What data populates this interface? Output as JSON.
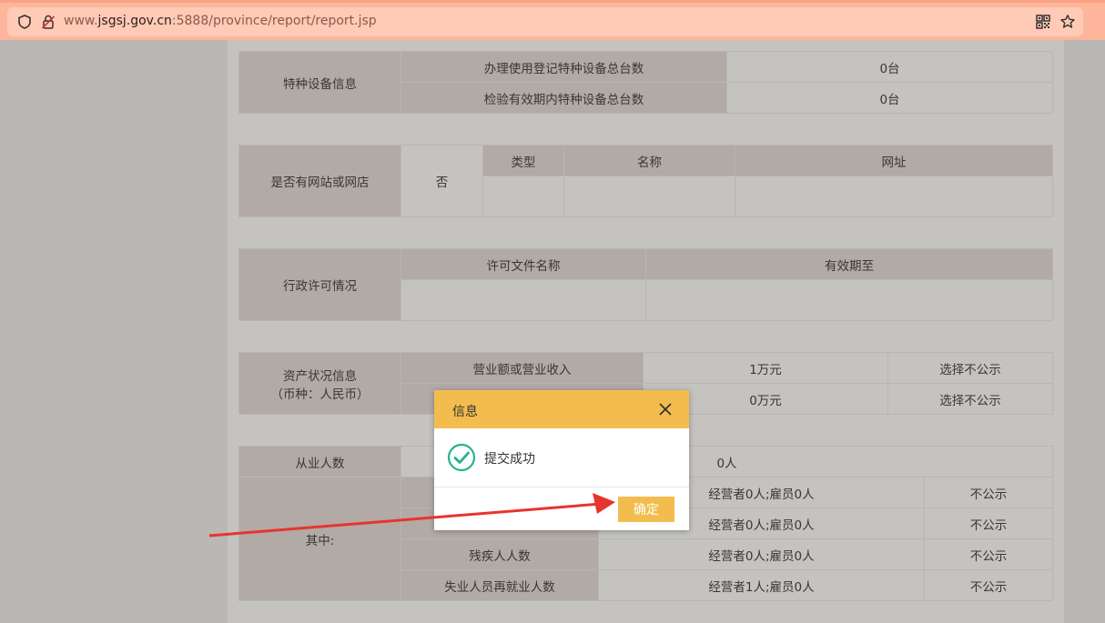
{
  "browser": {
    "url_prefix": "www.",
    "url_domain": "jsgsj.gov.cn",
    "url_rest": ":5888/province/report/report.jsp"
  },
  "special_equipment": {
    "label": "特种设备信息",
    "rows": [
      {
        "label": "办理使用登记特种设备总台数",
        "value": "0台"
      },
      {
        "label": "检验有效期内特种设备总台数",
        "value": "0台"
      }
    ]
  },
  "website": {
    "label": "是否有网站或网店",
    "value": "否",
    "columns": [
      "类型",
      "名称",
      "网址"
    ]
  },
  "license": {
    "label": "行政许可情况",
    "columns": [
      "许可文件名称",
      "有效期至"
    ]
  },
  "assets": {
    "label_line1": "资产状况信息",
    "label_line2": "（币种：人民币）",
    "rows": [
      {
        "label": "营业额或营业收入",
        "value": "1万元",
        "status": "选择不公示"
      },
      {
        "label": "",
        "value": "0万元",
        "status": "选择不公示"
      }
    ]
  },
  "employees": {
    "total_label": "从业人数",
    "total_value": "0人",
    "sub_label": "其中:",
    "rows": [
      {
        "label": "",
        "value": "经营者0人;雇员0人",
        "status": "不公示"
      },
      {
        "label": "",
        "value": "经营者0人;雇员0人",
        "status": "不公示"
      },
      {
        "label": "残疾人人数",
        "value": "经营者0人;雇员0人",
        "status": "不公示"
      },
      {
        "label": "失业人员再就业人数",
        "value": "经营者1人;雇员0人",
        "status": "不公示"
      }
    ]
  },
  "dialog": {
    "title": "信息",
    "message": "提交成功",
    "confirm_label": "确定"
  }
}
